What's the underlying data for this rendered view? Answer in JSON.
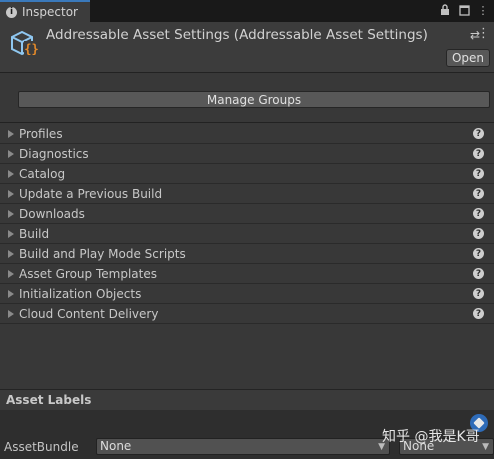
{
  "tab": {
    "title": "Inspector"
  },
  "header": {
    "title": "Addressable Asset Settings (Addressable Asset Settings)",
    "open_label": "Open"
  },
  "manage_groups_label": "Manage Groups",
  "foldouts": [
    "Profiles",
    "Diagnostics",
    "Catalog",
    "Update a Previous Build",
    "Downloads",
    "Build",
    "Build and Play Mode Scripts",
    "Asset Group Templates",
    "Initialization Objects",
    "Cloud Content Delivery"
  ],
  "asset_labels": {
    "title": "Asset Labels",
    "bundle_label": "AssetBundle",
    "bundle_value": "None",
    "variant_value": "None"
  },
  "watermark": "知乎 @我是K哥",
  "colors": {
    "accent": "#3a79bb",
    "tag": "#2e6bb8",
    "icon_braces": "#e58b2a",
    "icon_cube": "#8fc7f0"
  }
}
